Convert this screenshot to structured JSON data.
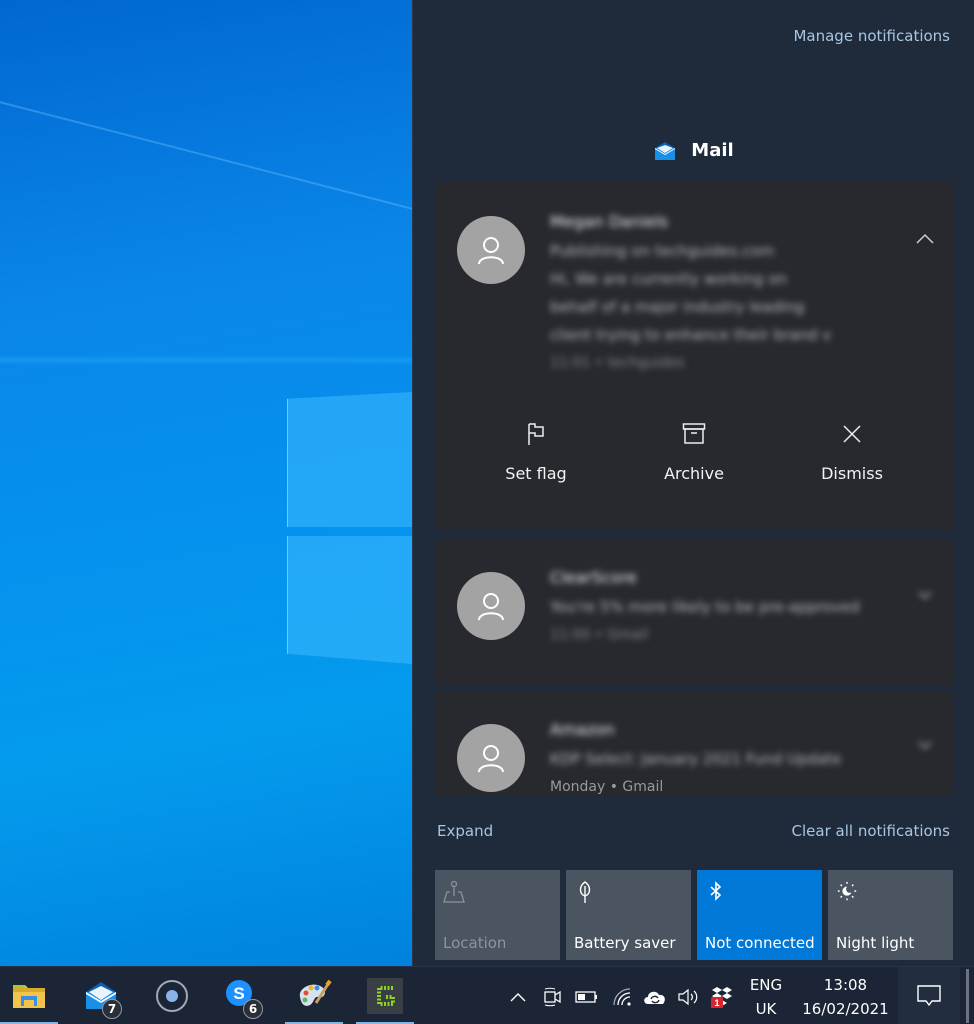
{
  "action_center": {
    "manage_notifications": "Manage notifications",
    "group": {
      "app_name": "Mail",
      "icon": "mail-icon"
    },
    "notifications": [
      {
        "sender": "Megan Daniels",
        "lines": [
          "Publishing on techguides.com",
          "Hi, We are currently working on",
          "behalf of a major industry leading",
          "client trying to enhance their brand v"
        ],
        "meta": "11:01 • techguides",
        "expanded": true,
        "actions": [
          {
            "label": "Set flag",
            "icon": "flag-icon"
          },
          {
            "label": "Archive",
            "icon": "archive-icon"
          },
          {
            "label": "Dismiss",
            "icon": "close-icon"
          }
        ]
      },
      {
        "sender": "ClearScore",
        "lines": [
          "You're 5% more likely to be pre-approved"
        ],
        "meta": "11:00 • Gmail",
        "expanded": false
      },
      {
        "sender": "Amazon",
        "lines": [
          "KDP Select: January 2021 Fund Update"
        ],
        "meta": "Monday • Gmail",
        "expanded": false
      }
    ],
    "expand_label": "Expand",
    "clear_all_label": "Clear all notifications",
    "quick_actions": [
      {
        "label": "Location",
        "icon": "location-icon",
        "state": "disabled"
      },
      {
        "label": "Battery saver",
        "icon": "battery-saver-icon",
        "state": "off"
      },
      {
        "label": "Not connected",
        "icon": "bluetooth-icon",
        "state": "on"
      },
      {
        "label": "Night light",
        "icon": "night-light-icon",
        "state": "off"
      }
    ]
  },
  "taskbar": {
    "apps": [
      {
        "name": "File Explorer",
        "icon": "file-explorer-icon",
        "running": true
      },
      {
        "name": "Mail",
        "icon": "mail-icon",
        "badge": "7",
        "running": false
      },
      {
        "name": "Cortana",
        "icon": "cortana-icon",
        "running": false
      },
      {
        "name": "Skype",
        "icon": "skype-icon",
        "badge": "6",
        "running": false
      },
      {
        "name": "Paint",
        "icon": "paint-icon",
        "running": true
      },
      {
        "name": "Greenshot",
        "icon": "greenshot-icon",
        "running": true
      }
    ],
    "tray": {
      "dropbox_badge": "1",
      "language_line1": "ENG",
      "language_line2": "UK",
      "time": "13:08",
      "date": "16/02/2021"
    }
  },
  "colors": {
    "accent": "#0078d7",
    "panel_bg": "#1f2a3b",
    "card_bg": "#27292e",
    "tile_bg": "#4a5561",
    "link": "#a9c6e0"
  }
}
